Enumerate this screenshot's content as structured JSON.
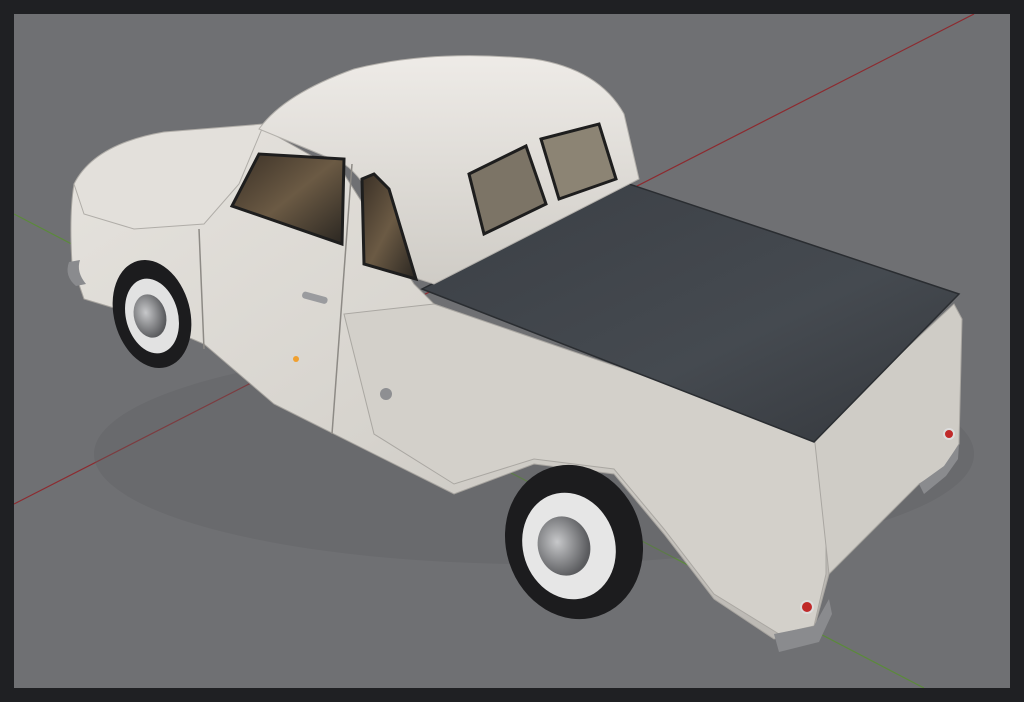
{
  "viewport": {
    "colors": {
      "background": "#6f7073",
      "frame": "#1f2023",
      "x_axis": "#8d2a2f",
      "y_axis": "#5b8a3a",
      "body_paint": "#d9d6d0",
      "tonneau_cover": "#3f4349",
      "tire": "#1c1c1e",
      "chrome": "#8a8b8e",
      "tail_light": "#c02a2a"
    },
    "model": {
      "icon": "pickup-truck-model"
    }
  }
}
